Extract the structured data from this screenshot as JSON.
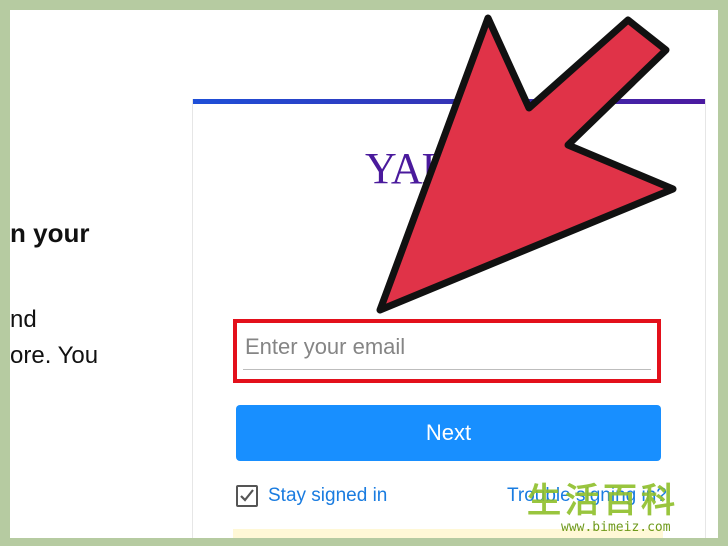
{
  "background": {
    "left_fragments": {
      "heading": "n your",
      "line1": "nd",
      "line2": "ore. You"
    }
  },
  "login": {
    "logo_text": "YAH",
    "email_placeholder": "Enter your email",
    "next_label": "Next",
    "stay_signed_in_label": "Stay signed in",
    "trouble_link": "Trouble signing in?"
  },
  "watermark": {
    "chars": [
      "生",
      "活",
      "百",
      "科"
    ],
    "url": "www.bimeiz.com"
  },
  "colors": {
    "brand_purple": "#4a1a9c",
    "button_blue": "#188fff",
    "link_blue": "#1a7ce0",
    "highlight_red": "#e3101b",
    "arrow_red": "#e03348",
    "frame_green": "#b6cba1"
  },
  "icons": {
    "arrow": "red-pointer-arrow",
    "checkbox": "checkbox-checked-icon"
  }
}
